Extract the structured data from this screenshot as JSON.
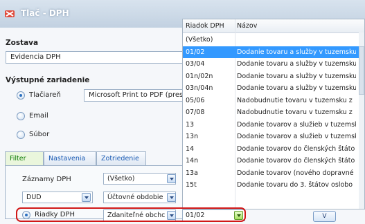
{
  "window": {
    "title": "Tlač - DPH"
  },
  "zostava": {
    "label": "Zostava",
    "value": "Evidencia DPH"
  },
  "output": {
    "label": "Výstupné zariadenie",
    "options": [
      {
        "label": "Tlačiareň",
        "selected": true
      },
      {
        "label": "Email",
        "selected": false
      },
      {
        "label": "Súbor",
        "selected": false
      }
    ],
    "printer": "Microsoft Print to PDF (presm"
  },
  "tabs": [
    {
      "label": "Filter",
      "active": true
    },
    {
      "label": "Nastavenia",
      "active": false
    },
    {
      "label": "Zotriedenie",
      "active": false
    }
  ],
  "filter": {
    "zaznamy_label": "Záznamy DPH",
    "zaznamy_value": "(Všetko)",
    "dud_value": "DUD",
    "obdobie_value": "Účtovné obdobie",
    "riadky_label": "Riadky DPH",
    "riadky_mode_value": "Zdaniteľné obchc",
    "riadky_value": "01/02"
  },
  "list": {
    "columns": [
      "Riadok DPH",
      "Názov"
    ],
    "rows": [
      {
        "code": "(Všetko)",
        "name": ""
      },
      {
        "code": "01/02",
        "name": "Dodanie tovaru a služby v tuzemsku",
        "selected": true
      },
      {
        "code": "03/04",
        "name": "Dodanie tovaru a služby v tuzemsku"
      },
      {
        "code": "01n/02n",
        "name": "Dodanie tovaru a služby v tuzemsku"
      },
      {
        "code": "03n/04n",
        "name": "Dodanie tovaru a služby v tuzemsku"
      },
      {
        "code": "05/06",
        "name": "Nadobudnutie tovaru v tuzemsku z"
      },
      {
        "code": "07/08",
        "name": "Nadobudnutie tovaru v tuzemsku z"
      },
      {
        "code": "13",
        "name": "Dodanie tovarov a služieb v tuzemsk"
      },
      {
        "code": "13n",
        "name": "Dodanie tovarov a služieb v tuzemsk"
      },
      {
        "code": "14",
        "name": "Dodanie tovarov do členských štáto"
      },
      {
        "code": "14n",
        "name": "Dodanie tovarov do členských štáto"
      },
      {
        "code": "13a",
        "name": "Dodanie tovarov (nového dopravné"
      },
      {
        "code": "15t",
        "name": "Dodanie tovaru do 3. štátov oslobo"
      }
    ]
  },
  "bottom_button": "V",
  "colors": {
    "selection": "#3399ff",
    "highlight_border": "#d11818",
    "active_tab": "#0a7a00"
  }
}
